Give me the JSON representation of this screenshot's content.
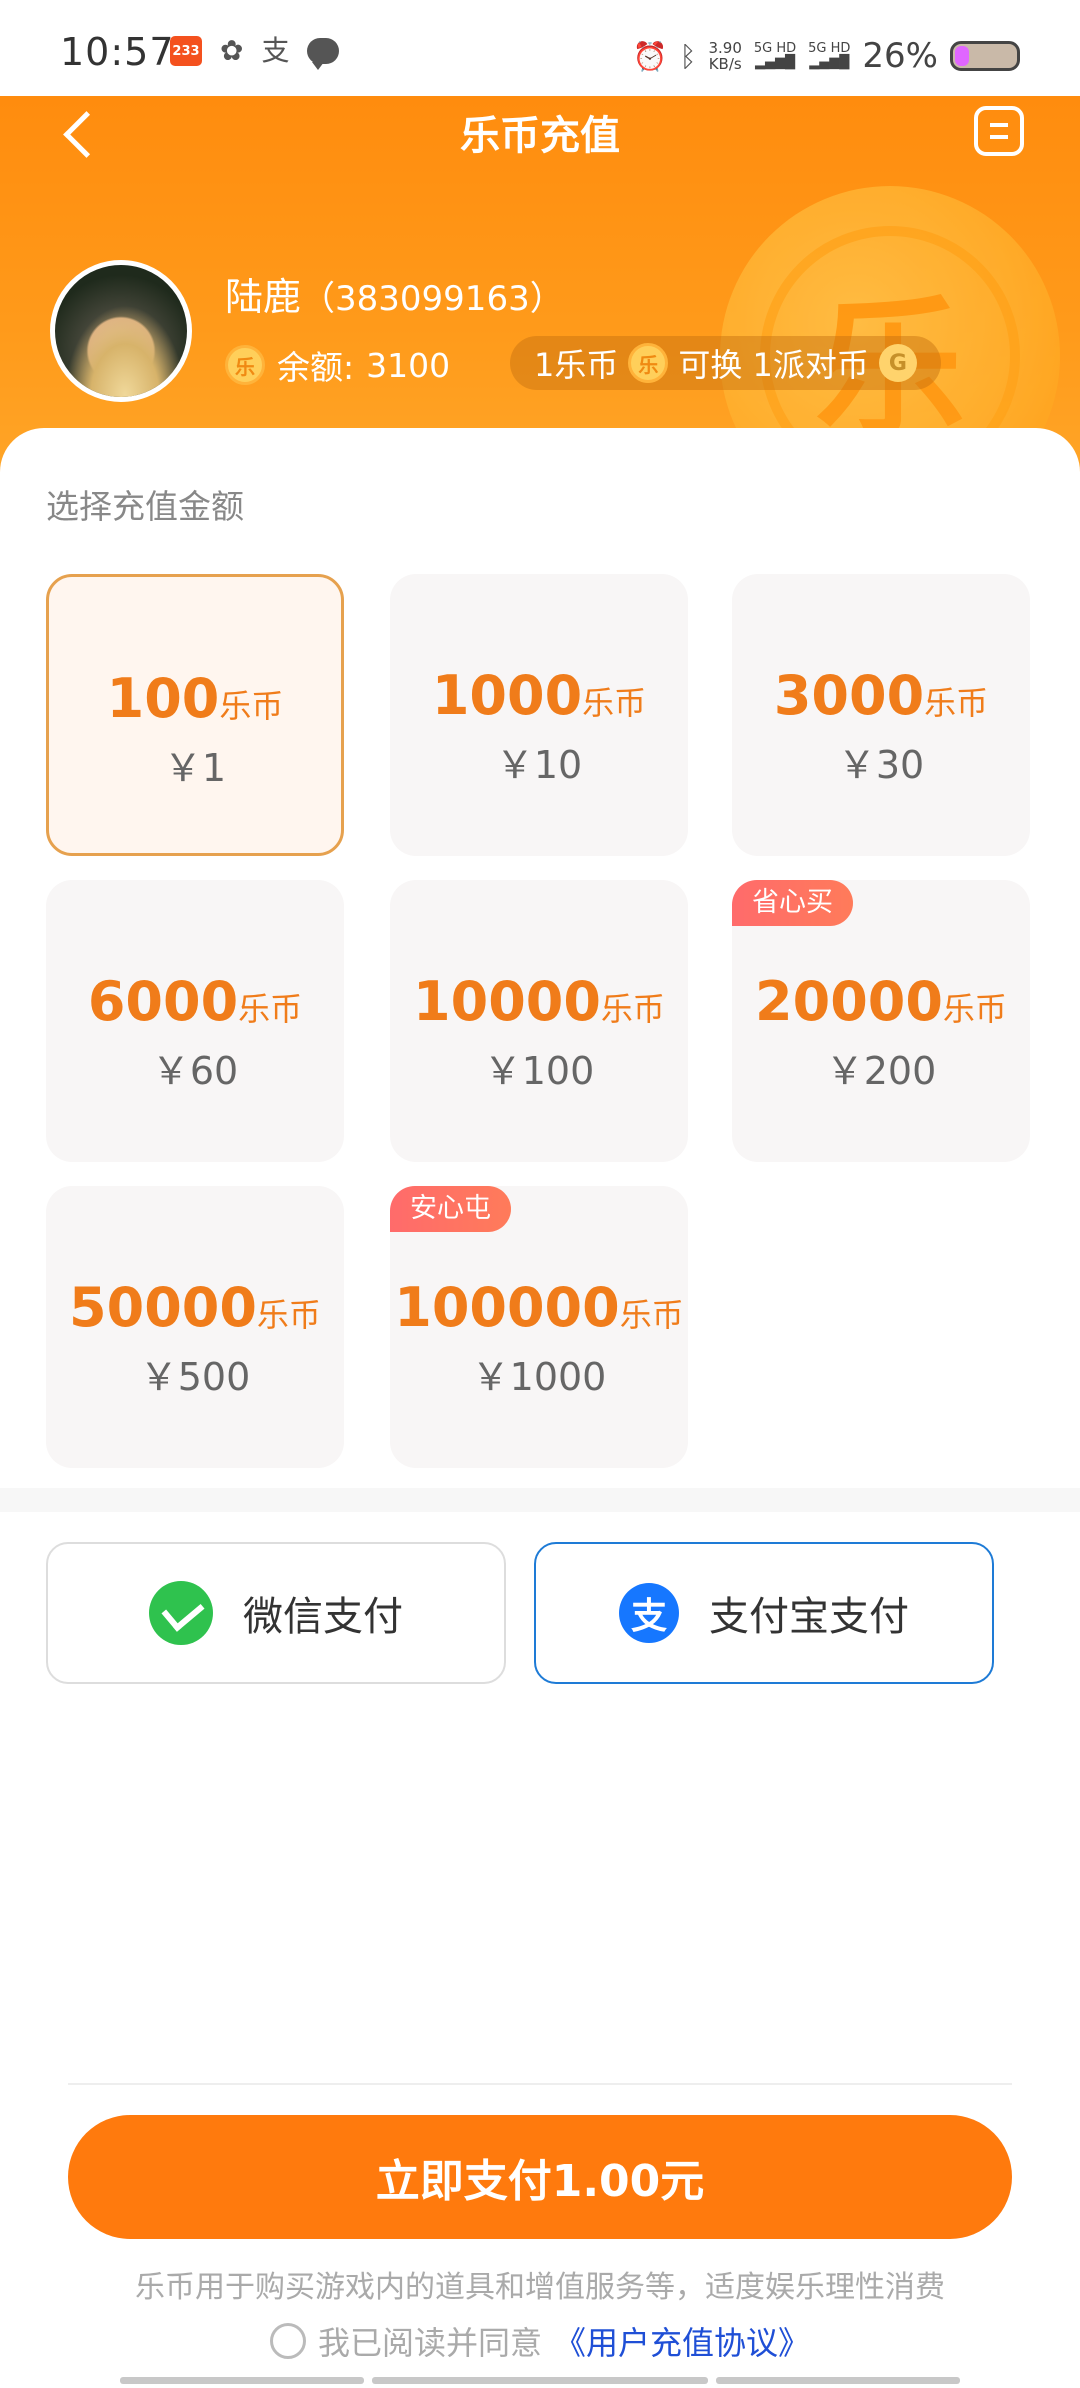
{
  "status_bar": {
    "time": "10:57",
    "app_badge": "233",
    "speed_value": "3.90",
    "speed_unit": "KB/s",
    "net1": "5G HD",
    "net2": "5G HD",
    "battery": "26%"
  },
  "header": {
    "title": "乐币充值",
    "coin_glyph": "乐",
    "user_name": "陆鹿",
    "user_id": "（383099163）",
    "balance_label": "余额:",
    "balance_value": "3100",
    "rate_left": "1乐币",
    "rate_mid": "可换 1派对币",
    "mini_coin_glyph": "乐",
    "hex_coin_glyph": "G"
  },
  "recharge": {
    "section_title": "选择充值金额",
    "unit": "乐币",
    "options": [
      {
        "coins": "100",
        "price": "￥1",
        "badge": "",
        "selected": true
      },
      {
        "coins": "1000",
        "price": "￥10",
        "badge": "",
        "selected": false
      },
      {
        "coins": "3000",
        "price": "￥30",
        "badge": "",
        "selected": false
      },
      {
        "coins": "6000",
        "price": "￥60",
        "badge": "",
        "selected": false
      },
      {
        "coins": "10000",
        "price": "￥100",
        "badge": "",
        "selected": false
      },
      {
        "coins": "20000",
        "price": "￥200",
        "badge": "省心买",
        "selected": false
      },
      {
        "coins": "50000",
        "price": "￥500",
        "badge": "",
        "selected": false
      },
      {
        "coins": "100000",
        "price": "￥1000",
        "badge": "安心屯",
        "selected": false
      }
    ]
  },
  "payment": {
    "wechat_label": "微信支付",
    "alipay_label": "支付宝支付",
    "alipay_glyph": "支",
    "selected": "alipay"
  },
  "footer": {
    "pay_button": "立即支付1.00元",
    "disclaimer": "乐币用于购买游戏内的道具和增值服务等，适度娱乐理性消费",
    "agree_text": "我已阅读并同意",
    "agree_link": "《用户充值协议》"
  },
  "colors": {
    "brand_orange": "#ff7a0d",
    "alipay_blue": "#1677ff",
    "wechat_green": "#2fc24e"
  }
}
